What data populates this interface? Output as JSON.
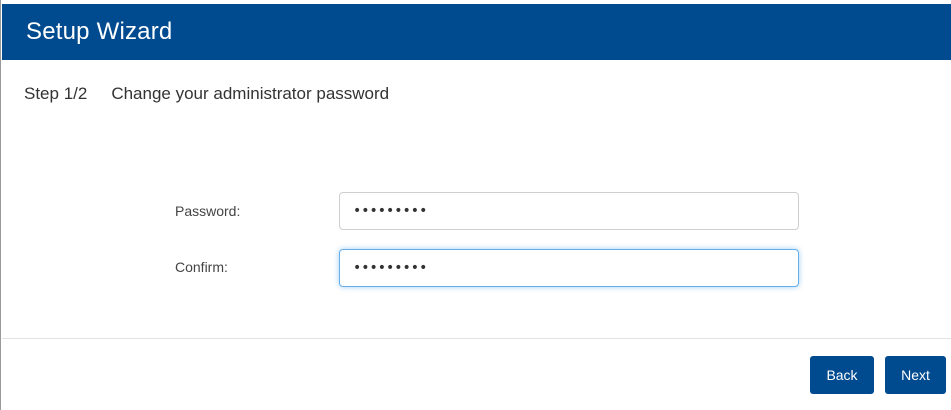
{
  "header": {
    "title": "Setup Wizard"
  },
  "step": {
    "number": "Step 1/2",
    "description": "Change your administrator password"
  },
  "form": {
    "password": {
      "label": "Password:",
      "value": "•••••••••"
    },
    "confirm": {
      "label": "Confirm:",
      "value": "•••••••••"
    }
  },
  "footer": {
    "back_label": "Back",
    "next_label": "Next"
  },
  "colors": {
    "header_bg": "#004a8f",
    "button_bg": "#004a8f",
    "focus_border": "#66afe9"
  }
}
